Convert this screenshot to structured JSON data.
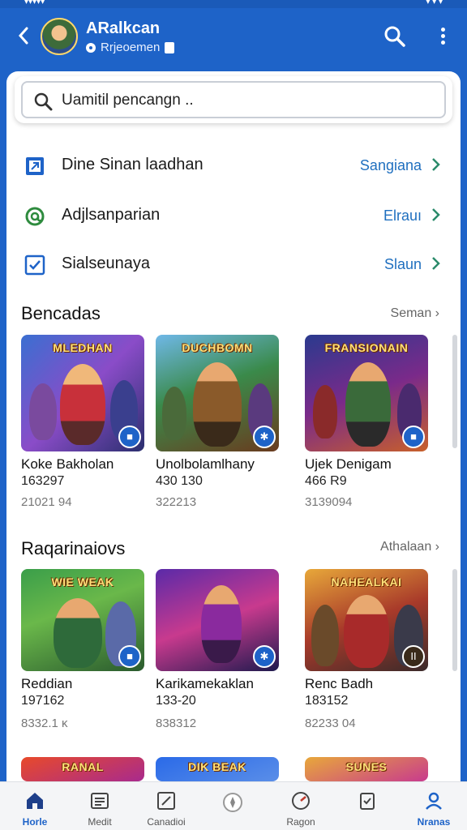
{
  "status": {
    "left": "▾▾▾▾▾",
    "right": "▾ ▾ ▾"
  },
  "header": {
    "title": "ARalkcan",
    "subtitle": "Rrjeoemen"
  },
  "search": {
    "placeholder": "Uamitil pencangn .."
  },
  "rows": [
    {
      "label": "Dine Sinan laadhan",
      "value": "Sangiana",
      "icon": "square-arrow-icon"
    },
    {
      "label": "Adjlsanparian",
      "value": "Elrauı",
      "icon": "at-sign-icon"
    },
    {
      "label": "Sialseunaya",
      "value": "Slaun",
      "icon": "edit-box-icon"
    }
  ],
  "sections": [
    {
      "title": "Bencadas",
      "more": "Seman",
      "items": [
        {
          "art": "MLEDHAN",
          "name": "Koke Bakholan",
          "sub": "163297",
          "meta": "21021 94",
          "badge": "■"
        },
        {
          "art": "DUCHBOMN",
          "name": "Unolbolamlhany",
          "sub": "430 130",
          "meta": "322213",
          "badge": "✱"
        },
        {
          "art": "FRANSIONAIN",
          "name": "Ujek Denigam",
          "sub": "466 R9",
          "meta": "3139094",
          "badge": "■"
        }
      ]
    },
    {
      "title": "Raqarinaiovs",
      "more": "Athalaan",
      "items": [
        {
          "art": "WIE WEAK",
          "name": "Reddian",
          "sub": "197162",
          "meta": "8332.1 κ",
          "badge": "■"
        },
        {
          "art": "",
          "name": "Karikamekaklan",
          "sub": "133-20",
          "meta": "838312",
          "badge": "✱"
        },
        {
          "art": "NAHEALKAI",
          "name": "Renc Badh",
          "sub": "183152",
          "meta": "82233 04",
          "badge": "II"
        }
      ]
    }
  ],
  "third_row_arts": [
    "RANAL",
    "DIK BEAK",
    "SUNES"
  ],
  "nav": [
    {
      "label": "Horle",
      "icon": "home-icon",
      "active": true
    },
    {
      "label": "Medit",
      "icon": "news-icon",
      "active": false
    },
    {
      "label": "Canadioi",
      "icon": "edit-icon",
      "active": false
    },
    {
      "label": "",
      "icon": "compass-icon",
      "active": false
    },
    {
      "label": "Ragon",
      "icon": "gauge-icon",
      "active": false
    },
    {
      "label": "",
      "icon": "clipboard-icon",
      "active": false
    },
    {
      "label": "Nranas",
      "icon": "profile-icon",
      "active": true
    }
  ],
  "colors": {
    "brand": "#1e63c8",
    "link": "#1f6fbf"
  }
}
